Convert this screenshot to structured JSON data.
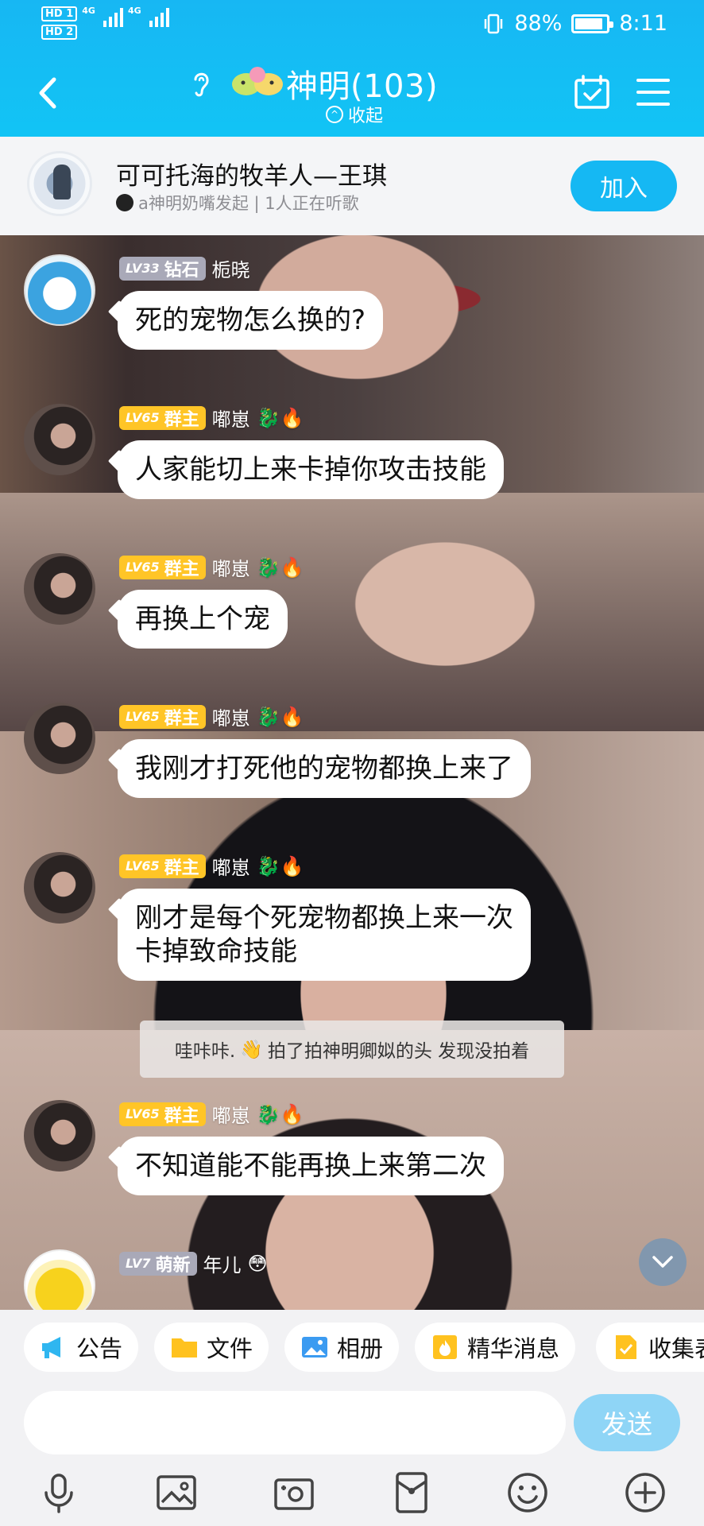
{
  "status_bar": {
    "sim1": "HD 1",
    "sim2": "HD 2",
    "net1": "4G",
    "net2": "4G",
    "battery": "88%",
    "time": "8:11"
  },
  "header": {
    "title": "神明(103)",
    "collapse_label": "收起",
    "icons": [
      "back-icon",
      "ear-icon",
      "calendar-check-icon",
      "menu-icon"
    ]
  },
  "music": {
    "song_title": "可可托海的牧羊人—王琪",
    "subtitle": "a神明奶嘴发起 | 1人正在听歌",
    "join_label": "加入"
  },
  "messages": [
    {
      "level": "LV33",
      "rank": "钻石",
      "rank_type": "diamond",
      "name": "栀晓",
      "emoji": "",
      "text": "死的宠物怎么换的?"
    },
    {
      "level": "LV65",
      "rank": "群主",
      "rank_type": "owner",
      "name": "嘟崽",
      "emoji": "🐉🔥",
      "text": "人家能切上来卡掉你攻击技能"
    },
    {
      "level": "LV65",
      "rank": "群主",
      "rank_type": "owner",
      "name": "嘟崽",
      "emoji": "🐉🔥",
      "text": "再换上个宠"
    },
    {
      "level": "LV65",
      "rank": "群主",
      "rank_type": "owner",
      "name": "嘟崽",
      "emoji": "🐉🔥",
      "text": "我刚才打死他的宠物都换上来了"
    },
    {
      "level": "LV65",
      "rank": "群主",
      "rank_type": "owner",
      "name": "嘟崽",
      "emoji": "🐉🔥",
      "text_line1": "刚才是每个死宠物都换上来一次",
      "text_line2": "卡掉致命技能"
    },
    {
      "level": "LV65",
      "rank": "群主",
      "rank_type": "owner",
      "name": "嘟崽",
      "emoji": "🐉🔥",
      "text": "不知道能不能再换上来第二次"
    },
    {
      "level": "LV7",
      "rank": "萌新",
      "rank_type": "newbie",
      "name": "年儿",
      "emoji": "😳"
    }
  ],
  "system_message": {
    "before": "哇咔咔.",
    "emoji": "👋",
    "after": "拍了拍神明卿姒的头 发现没拍着"
  },
  "toolbar": [
    {
      "label": "公告",
      "icon": "megaphone-icon",
      "color": "#2fb6f0"
    },
    {
      "label": "文件",
      "icon": "folder-icon",
      "color": "#ffc21f"
    },
    {
      "label": "相册",
      "icon": "photo-icon",
      "color": "#3b9bf1"
    },
    {
      "label": "精华消息",
      "icon": "flame-badge-icon",
      "color": "#ffc21f"
    },
    {
      "label": "收集表",
      "icon": "checklist-icon",
      "color": "#ffc21f"
    }
  ],
  "composer": {
    "placeholder": "",
    "send_label": "发送"
  },
  "bottom_icons": [
    "microphone-icon",
    "image-icon",
    "camera-icon",
    "red-packet-icon",
    "emoji-icon",
    "plus-icon"
  ],
  "colors": {
    "header_blue": "#17b7f3",
    "owner_badge": "#ffc527",
    "member_badge": "#a9a9b8",
    "send_button": "#8fd5f6"
  }
}
